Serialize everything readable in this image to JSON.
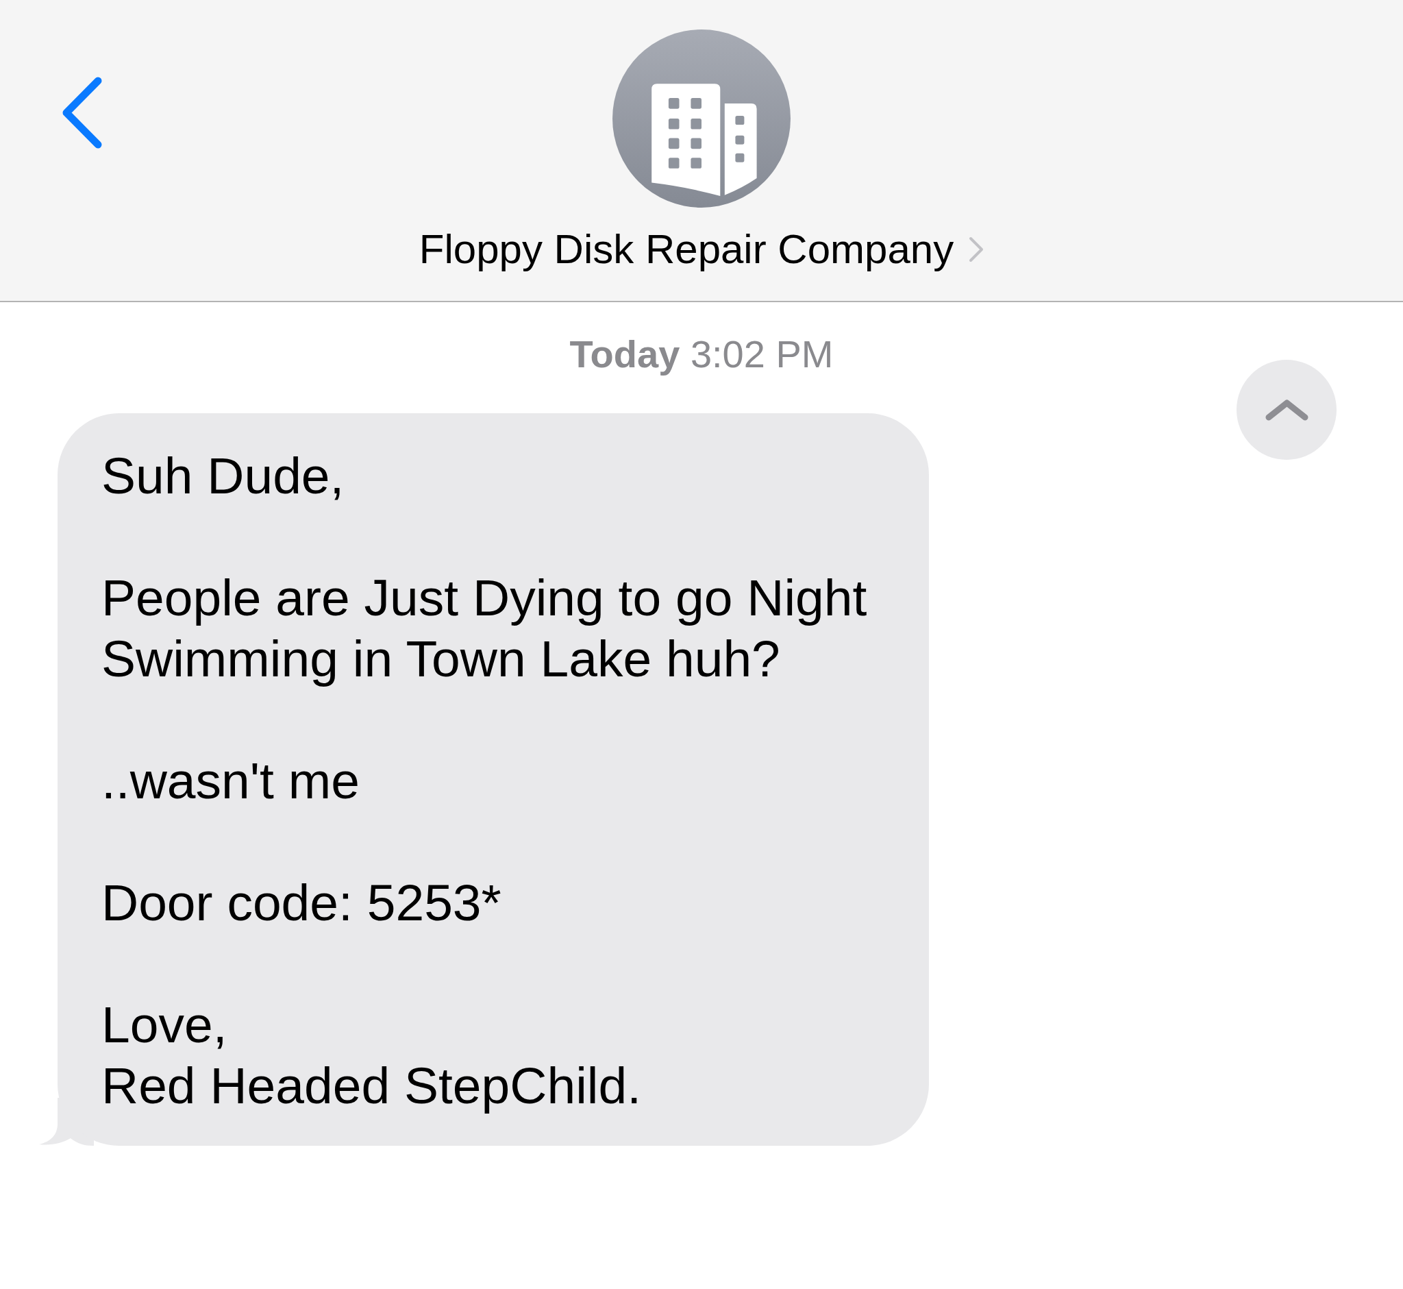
{
  "header": {
    "contact_name": "Floppy Disk Repair Company"
  },
  "timestamp": "**Today** 3:02 PM",
  "messages": [
    {
      "kind": "incoming",
      "paragraphs": [
        "Suh Dude,",
        "People are Just Dying to go Night Swimming in Town Lake huh?",
        "..wasn't me",
        "Door code: 5253*",
        "Love,\nRed Headed StepChild."
      ]
    }
  ]
}
